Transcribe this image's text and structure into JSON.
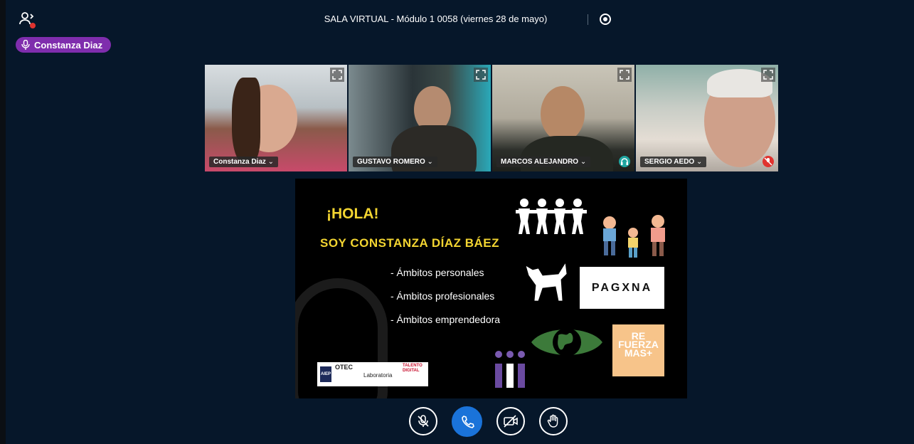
{
  "header": {
    "title": "SALA VIRTUAL - Módulo 1 0058 (viernes 28 de mayo)"
  },
  "talking_indicator": {
    "name": "Constanza Diaz"
  },
  "participants": [
    {
      "name": "Constanza Diaz",
      "status_icon": "none"
    },
    {
      "name": "GUSTAVO ROMERO",
      "status_icon": "none"
    },
    {
      "name": "MARCOS ALEJANDRO",
      "status_icon": "headphones-icon",
      "status_color": "#1fa5a0"
    },
    {
      "name": "SERGIO AEDO",
      "status_icon": "muted-mic-icon",
      "status_color": "#e0332f"
    }
  ],
  "slide": {
    "greeting": "¡HOLA!",
    "intro": "SOY CONSTANZA DÍAZ BÁEZ",
    "bullets": [
      "- Ámbitos personales",
      "- Ámbitos profesionales",
      "- Ámbitos emprendedora"
    ],
    "logo_pagina": "PAGXNA",
    "logo_refuerza": [
      "RE",
      "FUERZA",
      "MAS+"
    ],
    "logo_otec": {
      "aiep": "AIEP",
      "otec": "OTEC",
      "lab": "Laboratoria",
      "talento": "TALENTO DIGITAL"
    }
  },
  "colors": {
    "background": "#06172a",
    "talker": "#7f2dad",
    "call_button": "#1a73d9",
    "slide_accent": "#f3d531"
  }
}
